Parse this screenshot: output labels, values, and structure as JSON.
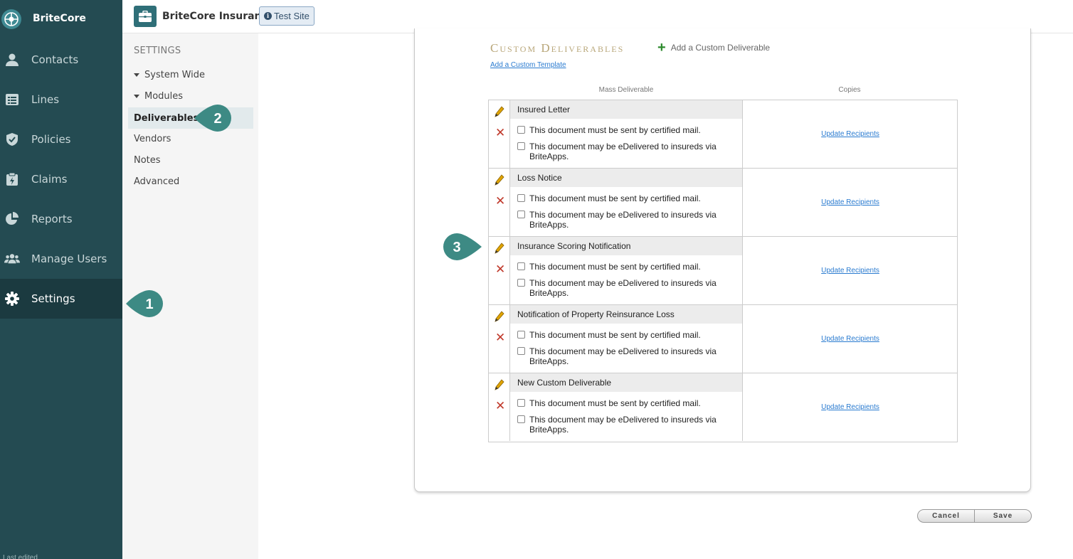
{
  "app": {
    "brand": "BriteCore"
  },
  "nav": {
    "items": [
      {
        "label": "Contacts",
        "icon": "person-icon"
      },
      {
        "label": "Lines",
        "icon": "list-icon"
      },
      {
        "label": "Policies",
        "icon": "shield-icon"
      },
      {
        "label": "Claims",
        "icon": "clipboard-icon"
      },
      {
        "label": "Reports",
        "icon": "pie-chart-icon"
      },
      {
        "label": "Manage Users",
        "icon": "users-icon"
      },
      {
        "label": "Settings",
        "icon": "gear-icon",
        "active": true
      }
    ],
    "footer": "Last edited"
  },
  "header": {
    "title": "BriteCore Insurance",
    "site_badge": "Test Site",
    "site_badge_icon": "i"
  },
  "settings_sidebar": {
    "section": "SETTINGS",
    "items": [
      {
        "label": "System Wide",
        "expandable": true
      },
      {
        "label": "Modules",
        "expandable": true
      },
      {
        "label": "Deliverables",
        "active": true
      },
      {
        "label": "Vendors"
      },
      {
        "label": "Notes"
      },
      {
        "label": "Advanced"
      }
    ]
  },
  "main": {
    "title": "Custom Deliverables",
    "add_custom_label": "Add a Custom Deliverable",
    "add_template_label": "Add a Custom Template",
    "columns": {
      "mass": "Mass Deliverable",
      "copies": "Copies"
    },
    "deliverables": [
      {
        "name": "Insured Letter",
        "opt1": "This document must be sent by certified mail.",
        "opt2": "This document may be eDelivered to insureds via BriteApps.",
        "copies_link": "Update Recipients"
      },
      {
        "name": "Loss Notice",
        "opt1": "This document must be sent by certified mail.",
        "opt2": "This document may be eDelivered to insureds via BriteApps.",
        "copies_link": "Update Recipients"
      },
      {
        "name": "Insurance Scoring Notification",
        "opt1": "This document must be sent by certified mail.",
        "opt2": "This document may be eDelivered to insureds via BriteApps.",
        "copies_link": "Update Recipients"
      },
      {
        "name": "Notification of Property Reinsurance Loss",
        "opt1": "This document must be sent by certified mail.",
        "opt2": "This document may be eDelivered to insureds via BriteApps.",
        "copies_link": "Update Recipients"
      },
      {
        "name": "New Custom Deliverable",
        "opt1": "This document must be sent by certified mail.",
        "opt2": "This document may be eDelivered to insureds via BriteApps.",
        "copies_link": "Update Recipients"
      }
    ],
    "buttons": {
      "cancel": "Cancel",
      "save": "Save"
    }
  },
  "callouts": [
    "1",
    "2",
    "3"
  ],
  "colors": {
    "nav_bg": "#244b52",
    "accent": "#2f6f78",
    "callout": "#3d8a84",
    "link": "#2a7bd0"
  }
}
